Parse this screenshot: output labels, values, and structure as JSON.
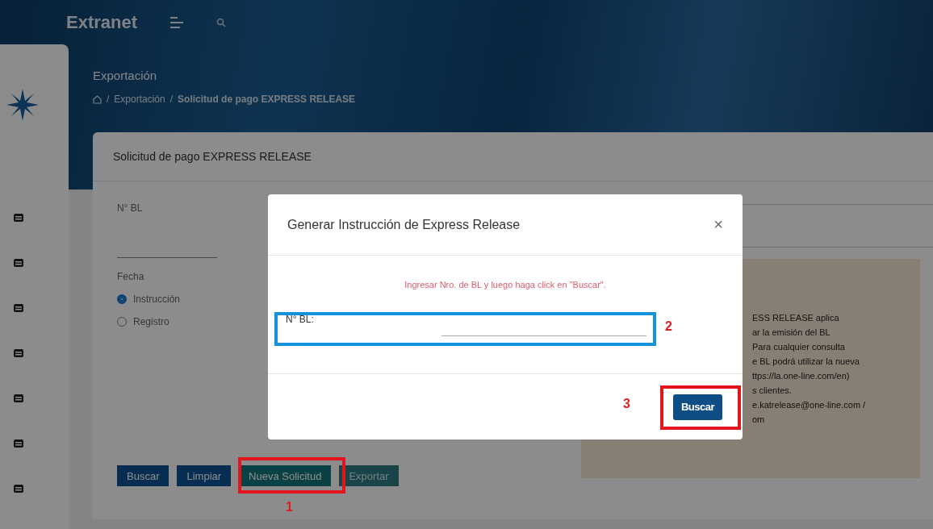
{
  "topbar": {
    "brand": "Extranet"
  },
  "page": {
    "title": "Exportación",
    "separator": "/",
    "breadcrumb": [
      "Exportación",
      "Solicitud de pago EXPRESS RELEASE"
    ]
  },
  "card": {
    "title": "Solicitud de pago EXPRESS RELEASE",
    "bl_label": "N° BL",
    "date_label": "Fecha",
    "radios": [
      {
        "label": "Instrucción",
        "selected": true
      },
      {
        "label": "Registro",
        "selected": false
      }
    ],
    "info_lines": [
      "ESS RELEASE aplica",
      "ar la emisión del BL",
      "Para cualquier consulta",
      "e BL podrá utilizar la nueva",
      "ttps://la.one-line.com/en)",
      "s clientes.",
      "e.katrelease@one-line.com /",
      "om"
    ],
    "buttons": [
      {
        "label": "Buscar",
        "kind": "primary",
        "disabled": false
      },
      {
        "label": "Limpiar",
        "kind": "primary",
        "disabled": false
      },
      {
        "label": "Nueva Solicitud",
        "kind": "teal",
        "disabled": false
      },
      {
        "label": "Exportar",
        "kind": "teal",
        "disabled": true
      }
    ]
  },
  "modal": {
    "title": "Generar Instrucción de Express Release",
    "close": "×",
    "message": "Ingresar Nro. de BL y luego haga click en \"Buscar\".",
    "field_label": "N° BL:",
    "button": "Buscar"
  },
  "annotations": [
    {
      "number": "1"
    },
    {
      "number": "2"
    },
    {
      "number": "3"
    }
  ]
}
